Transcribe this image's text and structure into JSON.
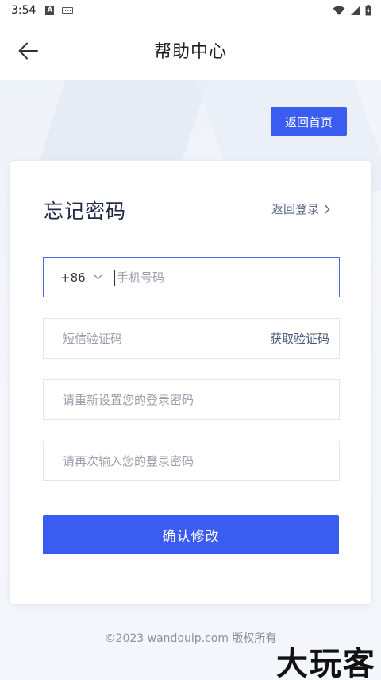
{
  "status_bar": {
    "time": "3:54",
    "icons": [
      "a-badge-icon",
      "keyboard-icon",
      "wifi-icon",
      "signal-icon",
      "battery-charging-icon"
    ]
  },
  "header": {
    "title": "帮助中心",
    "back_icon": "arrow-left-icon"
  },
  "home_button_label": "返回首页",
  "form": {
    "title": "忘记密码",
    "back_login_label": "返回登录",
    "country_code": "+86",
    "phone_placeholder": "手机号码",
    "sms_placeholder": "短信验证码",
    "get_code_label": "获取验证码",
    "new_password_placeholder": "请重新设置您的登录密码",
    "confirm_password_placeholder": "请再次输入您的登录密码",
    "submit_label": "确认修改"
  },
  "footer": {
    "copyright": "©2023 wandouip.com 版权所有"
  },
  "watermark": "大玩客",
  "colors": {
    "primary": "#3a5cf0",
    "focus_border": "#4a67e8",
    "page_bg": "#f3f6fb"
  }
}
